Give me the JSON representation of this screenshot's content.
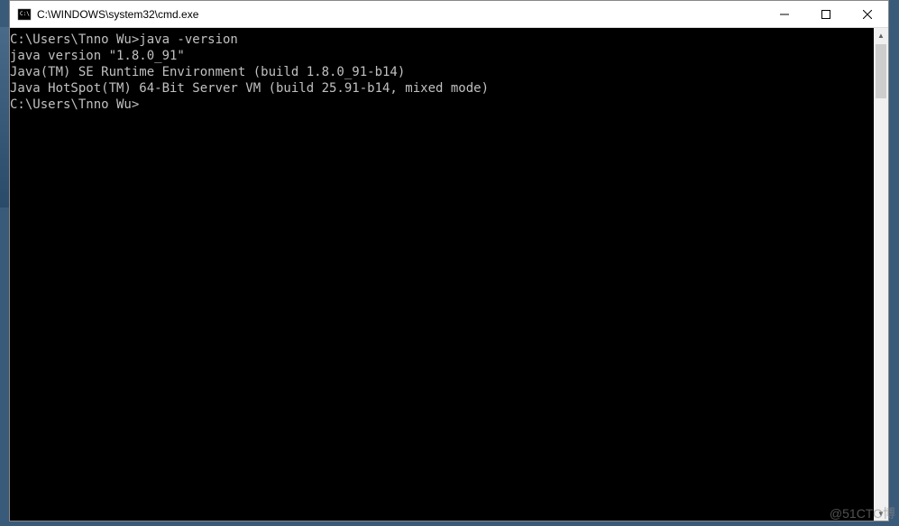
{
  "window": {
    "title": "C:\\WINDOWS\\system32\\cmd.exe"
  },
  "terminal": {
    "lines": [
      "",
      "C:\\Users\\Tnno Wu>java -version",
      "java version \"1.8.0_91\"",
      "Java(TM) SE Runtime Environment (build 1.8.0_91-b14)",
      "Java HotSpot(TM) 64-Bit Server VM (build 25.91-b14, mixed mode)",
      "",
      "C:\\Users\\Tnno Wu>"
    ]
  },
  "watermark": "@51CTO博"
}
